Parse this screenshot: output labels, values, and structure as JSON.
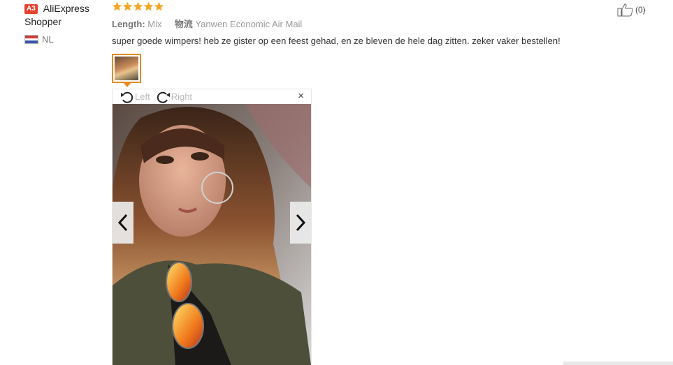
{
  "reviewer": {
    "level": "A3",
    "name_line1": "AliExpress",
    "name_line2": "Shopper",
    "country": "NL"
  },
  "review": {
    "rating": 5,
    "length_label": "Length:",
    "length_value": "Mix",
    "shipping_label": "物流",
    "shipping_value": "Yanwen Economic Air Mail",
    "text": "super goede wimpers! heb ze gister op een feest gehad, en ze bleven de hele dag zitten. zeker vaker bestellen!"
  },
  "viewer": {
    "rotate_left_label": "Left",
    "rotate_right_label": "Right",
    "close_glyph": "×"
  },
  "like": {
    "count": "(0)"
  },
  "colors": {
    "star": "#f5a623",
    "accent_border": "#e68a1f",
    "badge": "#e8412c"
  },
  "icons": [
    "star-icon",
    "rotate-left-icon",
    "rotate-right-icon",
    "close-icon",
    "chevron-left-icon",
    "chevron-right-icon",
    "thumbs-up-icon",
    "flag-nl-icon"
  ]
}
